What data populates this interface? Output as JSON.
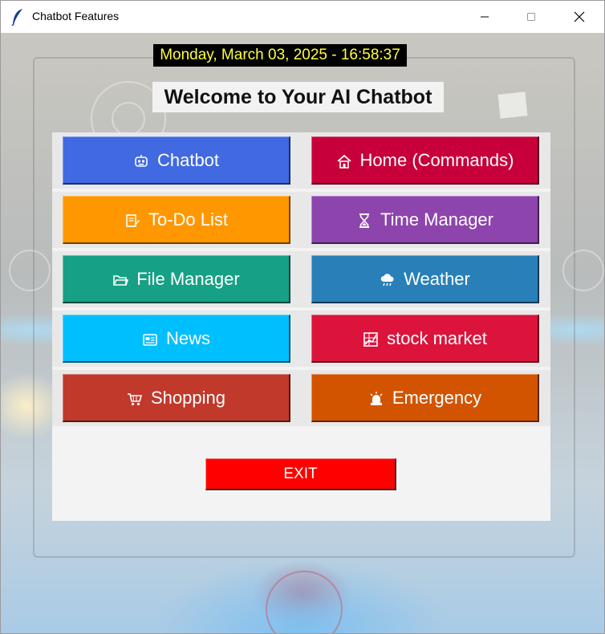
{
  "window": {
    "title": "Chatbot Features",
    "app_icon": "feather-icon"
  },
  "header": {
    "datetime": "Monday, March 03, 2025 - 16:58:37",
    "welcome": "Welcome to Your AI Chatbot"
  },
  "features": {
    "chatbot": {
      "label": "Chatbot",
      "icon": "robot-icon",
      "color": "#4169e1"
    },
    "home": {
      "label": "Home (Commands)",
      "icon": "house-icon",
      "color": "#c70039"
    },
    "todo": {
      "label": "To-Do List",
      "icon": "notepad-icon",
      "color": "#ff9800"
    },
    "time": {
      "label": "Time Manager",
      "icon": "hourglass-icon",
      "color": "#8e44ad"
    },
    "files": {
      "label": "File Manager",
      "icon": "folder-icon",
      "color": "#16a085"
    },
    "weather": {
      "label": "Weather",
      "icon": "rain-cloud-icon",
      "color": "#2980b9"
    },
    "news": {
      "label": "News",
      "icon": "newspaper-icon",
      "color": "#00bfff"
    },
    "stocks": {
      "label": "stock market",
      "icon": "chart-grid-icon",
      "color": "#dc143c"
    },
    "shopping": {
      "label": "Shopping",
      "icon": "cart-icon",
      "color": "#c0392b"
    },
    "emergency": {
      "label": "Emergency",
      "icon": "siren-icon",
      "color": "#d35400"
    }
  },
  "exit": {
    "label": "EXIT",
    "color": "#ff0000"
  }
}
